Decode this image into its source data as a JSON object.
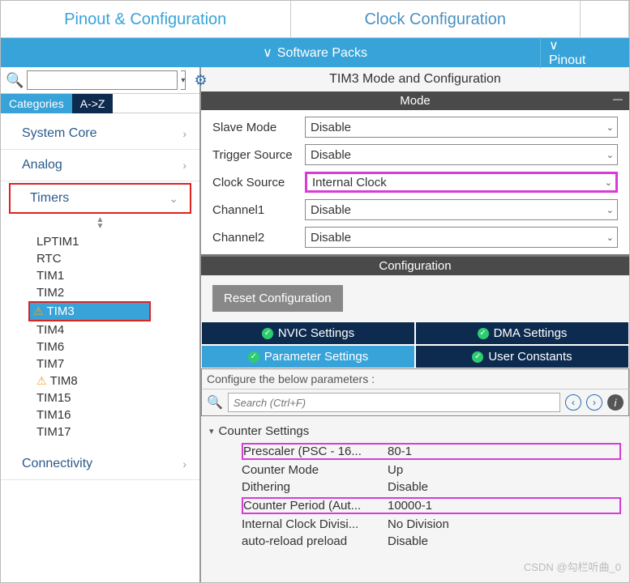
{
  "topnav": {
    "pinout": "Pinout & Configuration",
    "clock": "Clock Configuration"
  },
  "subnav": {
    "software_packs": "Software Packs",
    "pinout": "Pinout"
  },
  "search": {
    "placeholder": ""
  },
  "left_tabs": {
    "categories": "Categories",
    "az": "A->Z"
  },
  "categories": {
    "system_core": "System Core",
    "analog": "Analog",
    "timers": "Timers",
    "connectivity": "Connectivity"
  },
  "timers_list": [
    "LPTIM1",
    "RTC",
    "TIM1",
    "TIM2",
    "TIM3",
    "TIM4",
    "TIM6",
    "TIM7",
    "TIM8",
    "TIM15",
    "TIM16",
    "TIM17"
  ],
  "warn_items": [
    "TIM3",
    "TIM8"
  ],
  "selected_timer": "TIM3",
  "right": {
    "title": "TIM3 Mode and Configuration",
    "mode_header": "Mode",
    "config_header": "Configuration",
    "reset_btn": "Reset Configuration",
    "mode_rows": {
      "slave_mode": {
        "label": "Slave Mode",
        "value": "Disable"
      },
      "trigger_source": {
        "label": "Trigger Source",
        "value": "Disable"
      },
      "clock_source": {
        "label": "Clock Source",
        "value": "Internal Clock"
      },
      "channel1": {
        "label": "Channel1",
        "value": "Disable"
      },
      "channel2": {
        "label": "Channel2",
        "value": "Disable"
      }
    },
    "subtabs": {
      "nvic": "NVIC Settings",
      "dma": "DMA Settings",
      "param": "Parameter Settings",
      "user": "User Constants"
    },
    "param_label": "Configure the below parameters :",
    "param_search": "Search (Ctrl+F)",
    "counter_group": "Counter Settings",
    "params": {
      "prescaler": {
        "name": "Prescaler (PSC - 16...",
        "value": "80-1"
      },
      "counter_mode": {
        "name": "Counter Mode",
        "value": "Up"
      },
      "dithering": {
        "name": "Dithering",
        "value": "Disable"
      },
      "counter_period": {
        "name": "Counter Period (Aut...",
        "value": "10000-1"
      },
      "clock_div": {
        "name": "Internal Clock Divisi...",
        "value": "No Division"
      },
      "auto_reload": {
        "name": "auto-reload preload",
        "value": "Disable"
      }
    }
  },
  "watermark": "CSDN @勾栏听曲_0"
}
